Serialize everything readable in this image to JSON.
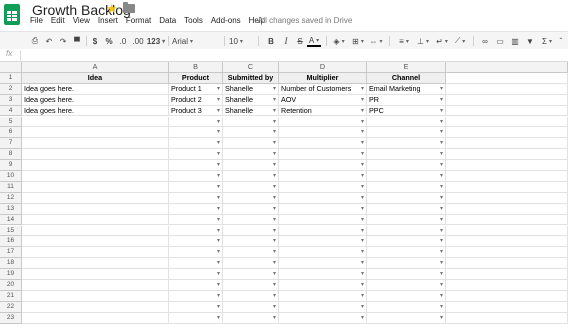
{
  "document": {
    "title": "Growth Backlog",
    "save_status": "All changes saved in Drive"
  },
  "colors": {
    "brand": "#0f9d58",
    "star": "#f4c20d"
  },
  "menu": [
    "File",
    "Edit",
    "View",
    "Insert",
    "Format",
    "Data",
    "Tools",
    "Add-ons",
    "Help"
  ],
  "toolbar": {
    "currency": "$",
    "percent": "%",
    "dec_less": ".0",
    "dec_more": ".00",
    "more_formats": "123",
    "font": "Arial",
    "font_size": "10",
    "bold": "B",
    "italic": "I",
    "strike": "S",
    "text_color": "A",
    "sigma": "Σ"
  },
  "formula_bar": {
    "fx_label": "fx",
    "value": ""
  },
  "grid": {
    "column_letters": [
      "A",
      "B",
      "C",
      "D",
      "E"
    ],
    "headers": [
      "Idea",
      "Product",
      "Submitted by",
      "Multiplier",
      "Channel"
    ],
    "rows": [
      [
        "Idea goes here.",
        "Product 1",
        "Shanelle",
        "Number of Customers",
        "Email Marketing"
      ],
      [
        "Idea goes here.",
        "Product 2",
        "Shanelle",
        "AOV",
        "PR"
      ],
      [
        "Idea goes here.",
        "Product 3",
        "Shanelle",
        "Retention",
        "PPC"
      ]
    ],
    "row_numbers": [
      "1",
      "2",
      "3",
      "4",
      "5",
      "6",
      "7",
      "8",
      "9",
      "10",
      "11",
      "12",
      "13",
      "14",
      "15",
      "16",
      "17",
      "18",
      "19",
      "20",
      "21",
      "22",
      "23"
    ]
  }
}
